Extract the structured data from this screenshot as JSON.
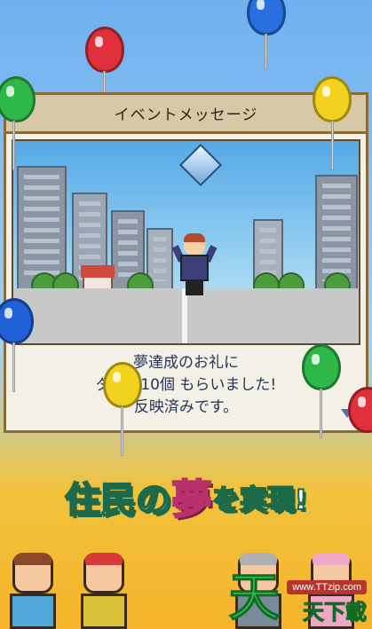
{
  "dialog": {
    "title": "イベントメッセージ",
    "message_lines": [
      "夢達成のお礼に",
      "ダイヤ10個 もらいました!",
      "反映済みです。"
    ]
  },
  "tagline": {
    "part1": "住民の",
    "part2": "夢",
    "part3": "を実現!"
  },
  "watermark": {
    "url": "www.TTzip.com",
    "logo_char": "天",
    "text": "天下載"
  },
  "colors": {
    "dialog_border": "#8a6a3a",
    "title_bar": "#d9c8a5",
    "message_text": "#27335a",
    "tagline_stroke": "#1d6a4a",
    "tagline_accent": "#f6a9c9"
  },
  "icons": [
    "diamond-icon",
    "next-arrow-icon",
    "balloon-icon"
  ]
}
